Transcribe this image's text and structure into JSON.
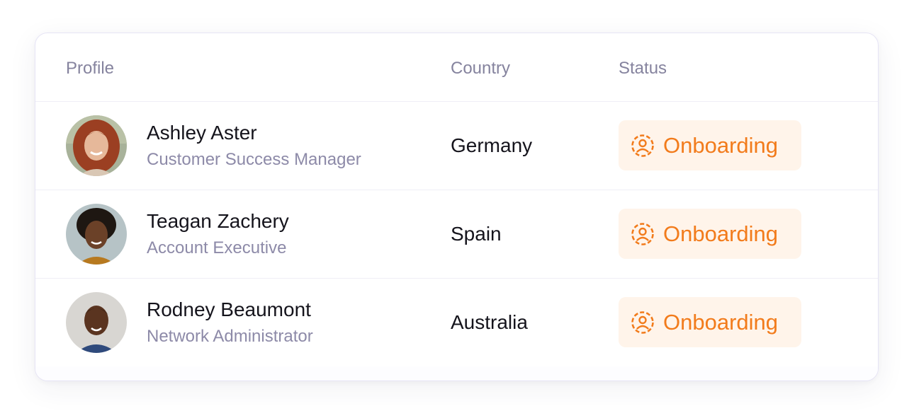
{
  "table": {
    "headers": {
      "profile": "Profile",
      "country": "Country",
      "status": "Status"
    },
    "rows": [
      {
        "name": "Ashley Aster",
        "role": "Customer Success Manager",
        "country": "Germany",
        "status": "Onboarding"
      },
      {
        "name": "Teagan Zachery",
        "role": "Account Executive",
        "country": "Spain",
        "status": "Onboarding"
      },
      {
        "name": "Rodney Beaumont",
        "role": "Network Administrator",
        "country": "Australia",
        "status": "Onboarding"
      }
    ]
  },
  "colors": {
    "status_onboarding_text": "#f27b1b",
    "status_onboarding_bg": "#fff4ea",
    "header_text": "#85839e",
    "secondary_text": "#8d8aa8",
    "primary_text": "#15141c"
  },
  "icons": {
    "status": "user-circle-dashed-icon"
  }
}
